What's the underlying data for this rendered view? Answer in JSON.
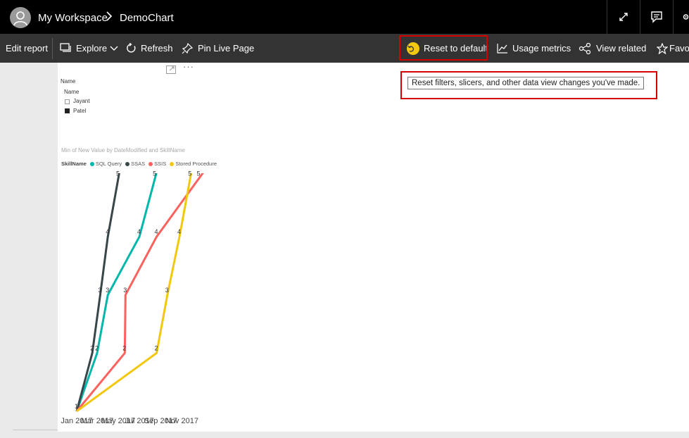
{
  "topbar": {
    "workspace": "My Workspace",
    "separator": ">",
    "report_name": "DemoChart"
  },
  "toolbar": {
    "edit_report": "Edit report",
    "explore": "Explore",
    "refresh": "Refresh",
    "pin_live_page": "Pin Live Page",
    "reset_to_default": "Reset to default",
    "usage_metrics": "Usage metrics",
    "view_related": "View related",
    "favorite": "Favor"
  },
  "tooltip": {
    "text": "Reset filters, slicers, and other data view changes you've made."
  },
  "slicer": {
    "title": "Name",
    "header": "Name",
    "items": [
      {
        "label": "Jayant",
        "checked": false
      },
      {
        "label": "Patel",
        "checked": true
      }
    ]
  },
  "chart_data": {
    "type": "line",
    "title": "Min of New Value by DateModified and SkillName",
    "legend_title": "SkillName",
    "x_ticks": [
      "Jan 2017",
      "Mar 2017",
      "May 2017",
      "Jul 2017",
      "Sep 2017",
      "Nov 2017"
    ],
    "series": [
      {
        "name": "SQL Query",
        "color": "#01b8aa",
        "points": [
          [
            "2017-01-01",
            1
          ],
          [
            "2017-03-01",
            2
          ],
          [
            "2017-04-01",
            3
          ],
          [
            "2017-07-01",
            4
          ],
          [
            "2017-08-15",
            5
          ]
        ]
      },
      {
        "name": "SSAS",
        "color": "#374649",
        "points": [
          [
            "2017-01-01",
            1
          ],
          [
            "2017-02-15",
            2
          ],
          [
            "2017-03-10",
            3
          ],
          [
            "2017-04-01",
            4
          ],
          [
            "2017-05-01",
            5
          ]
        ]
      },
      {
        "name": "SSIS",
        "color": "#fd625e",
        "points": [
          [
            "2017-01-01",
            1
          ],
          [
            "2017-05-20",
            2
          ],
          [
            "2017-05-22",
            3
          ],
          [
            "2017-08-20",
            4
          ],
          [
            "2017-12-20",
            5
          ]
        ]
      },
      {
        "name": "Stored Procedure",
        "color": "#f2c80f",
        "points": [
          [
            "2017-01-01",
            1
          ],
          [
            "2017-08-20",
            2
          ],
          [
            "2017-09-20",
            3
          ],
          [
            "2017-10-25",
            4
          ],
          [
            "2017-11-25",
            5
          ]
        ]
      }
    ]
  }
}
